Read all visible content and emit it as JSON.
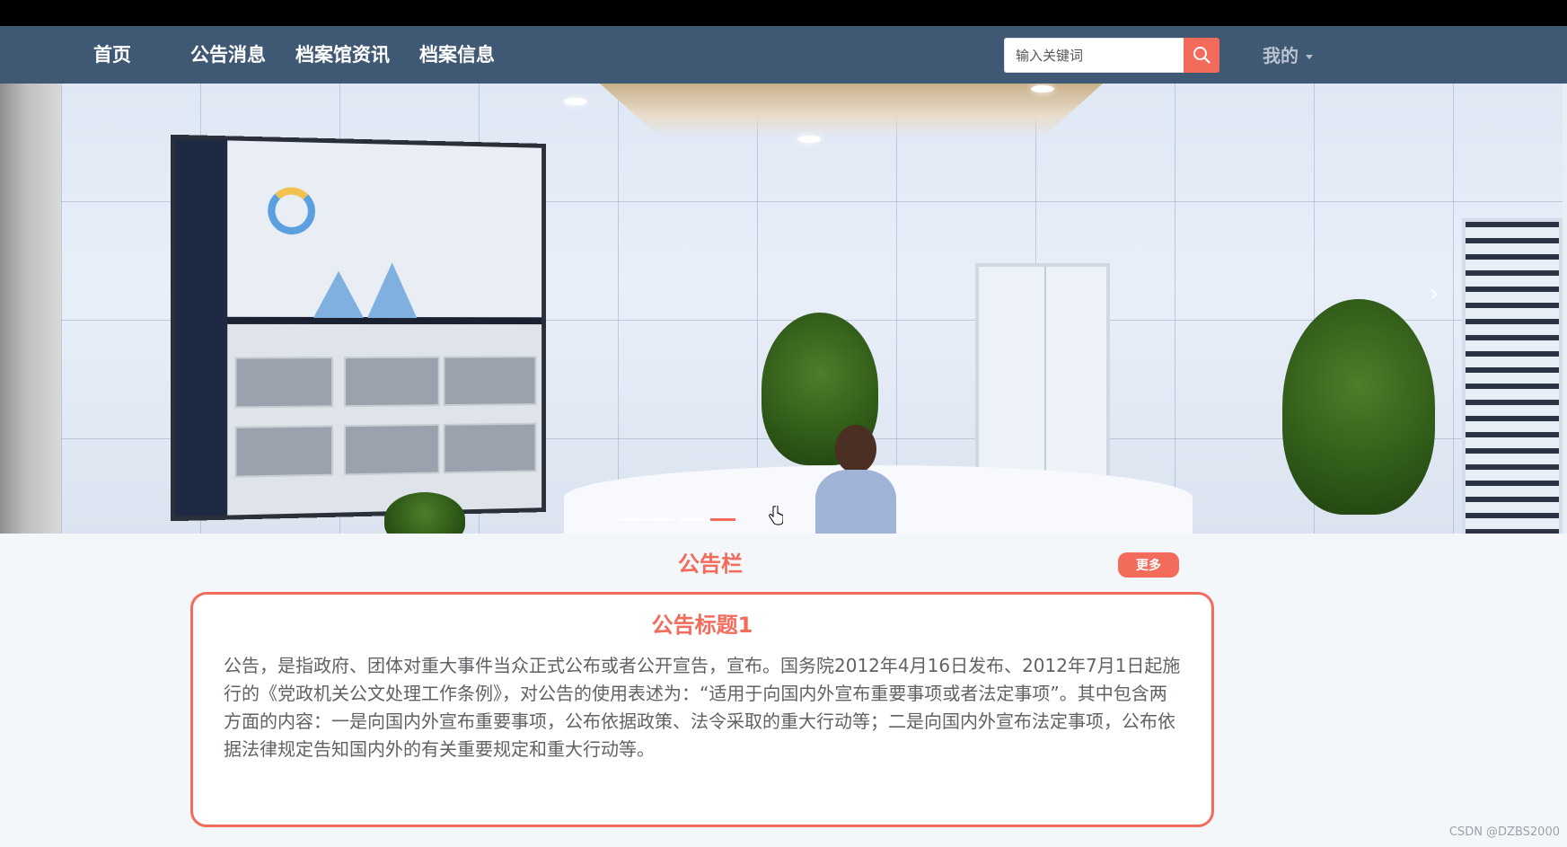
{
  "nav": {
    "items": [
      {
        "label": "首页"
      },
      {
        "label": "公告消息"
      },
      {
        "label": "档案馆资讯"
      },
      {
        "label": "档案信息"
      }
    ],
    "search": {
      "placeholder": "输入关键词",
      "icon": "search-icon"
    },
    "user_menu": {
      "label": "我的",
      "icon": "caret-down-icon"
    },
    "colors": {
      "bar": "#3f5873",
      "accent": "#f26b5b"
    }
  },
  "carousel": {
    "slide_count": 4,
    "active_index": 3,
    "next_icon": "chevron-right-icon"
  },
  "notice_board": {
    "title": "公告栏",
    "more_label": "更多",
    "card": {
      "title": "公告标题1",
      "body": "公告，是指政府、团体对重大事件当众正式公布或者公开宣告，宣布。国务院2012年4月16日发布、2012年7月1日起施行的《党政机关公文处理工作条例》，对公告的使用表述为：“适用于向国内外宣布重要事项或者法定事项”。其中包含两方面的内容：一是向国内外宣布重要事项，公布依据政策、法令采取的重大行动等；二是向国内外宣布法定事项，公布依据法律规定告知国内外的有关重要规定和重大行动等。"
    }
  },
  "watermark": "CSDN @DZBS2000"
}
